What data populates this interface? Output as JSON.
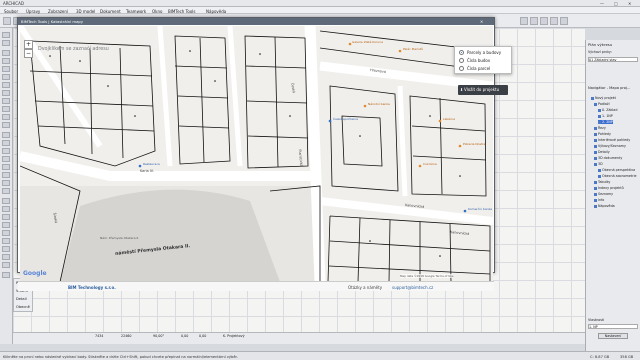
{
  "app": {
    "title": "ARCHICAD",
    "menu": [
      "Soubor",
      "Úpravy",
      "Zobrazení",
      "3D model",
      "Dokument",
      "Teamwork",
      "Okno",
      "BIMTech Tools",
      "Nápověda"
    ]
  },
  "map_window": {
    "title": "BIMTech Tools | Katastrální mapy",
    "search_hint": "Dvojklikem se zaznačí adresu",
    "layers": [
      "Parcely a budovy",
      "Čísla budov",
      "Čísla parcel"
    ],
    "selected_layer": 0,
    "export_button": "Vložit do projektu",
    "footer_brand": "BIM Technology s.r.o.",
    "footer_contact_prefix": "Otázky a náměty",
    "footer_contact_email": "support@bimtech.cz",
    "google_logo": "Google",
    "map_data": "Map data ©2018 Google",
    "terms": "Terms of Use",
    "report": "Report a map error",
    "plans": [
      {
        "text": "náměstí Přemysla Otakara II."
      },
      {
        "text": "Kanovnická"
      },
      {
        "text": "Hroznová"
      },
      {
        "text": "Česká"
      },
      {
        "text": "Piaristická"
      },
      {
        "text": "Široká"
      },
      {
        "text": "Karla IV."
      },
      {
        "text": "Nám. Přemysla Otakara II."
      }
    ],
    "pois": [
      "Galerie Zlatá Koruna",
      "Palác Piaristů",
      "Česká spořitelna",
      "Národní banka",
      "Restaurace",
      "Lékárna",
      "Hotel Zvon",
      "Měšťanský pivovar",
      "Komerční banka",
      "Pizzeria Nostra",
      "Hudební klub",
      "Cukrárna"
    ]
  },
  "right_panel": {
    "title1": "Plán výkresu",
    "subtitle1": "Výchozí prvky:",
    "layer_set": "01 Základní stav",
    "title2": "Navigátor - Mapa proj...",
    "tree": [
      "Nový projekt",
      "Podlaží",
      "0. Základ",
      "1. 1NP",
      "2. 2NP",
      "Řezy",
      "Pohledy",
      "Interiérové pohledy",
      "Výkazy/Seznamy",
      "Detaily",
      "3D dokumenty",
      "3D",
      "Obecná perspektiva",
      "Obecná axonometrie",
      "Tabulky",
      "Indexy projektů",
      "Seznamy",
      "Info",
      "Nápověda"
    ],
    "layers_label": "Vlastnosti",
    "layer_value": "1. NP",
    "settings_btn": "Nastavení"
  },
  "coords": {
    "x": "7434",
    "y": "22460",
    "angle": "90,00°",
    "dist": "0,00",
    "z": "0,00",
    "plane": "K. Projektový"
  },
  "left_props": [
    "Pracov...",
    "Vnitřní",
    "Detail",
    "Obecně"
  ],
  "status": {
    "message": "Klikněte na první nebo následné vybírací body. Stiskněte a držte Ctrl+Shift, pokud chcete přepínat na normální/elementární výběr.",
    "memory": "C: 8.87 GB",
    "ram": "358 GB"
  }
}
